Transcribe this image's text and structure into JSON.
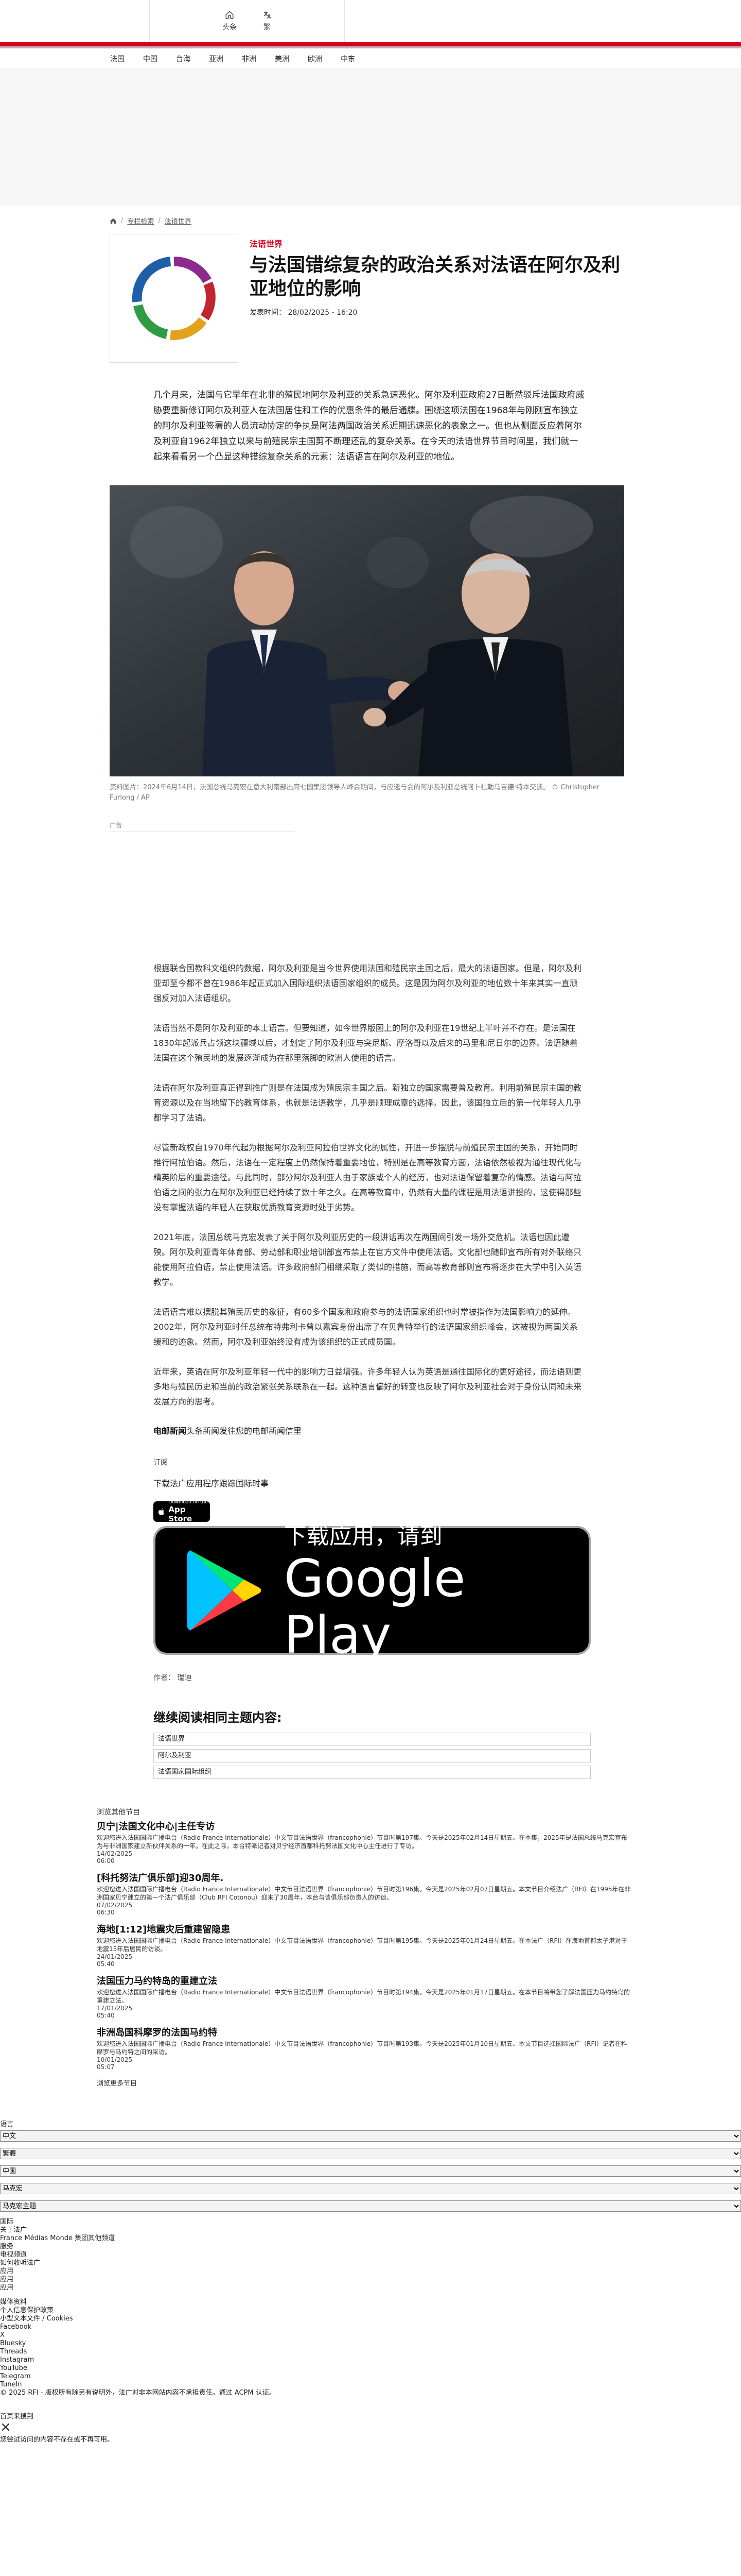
{
  "topbar": {
    "home_label": "头条",
    "lang_label": "繁"
  },
  "mainnav": [
    "法国",
    "中国",
    "台海",
    "亚洲",
    "非洲",
    "美洲",
    "欧洲",
    "中东"
  ],
  "breadcrumb": {
    "sep1": "/",
    "l1": "专栏检索",
    "sep2": "/",
    "l2": "法语世界"
  },
  "article": {
    "category": "法语世界",
    "title": "与法国错综复杂的政治关系对法语在阿尔及利亚地位的影响",
    "published": "发表时间： 28/02/2025 - 16:20",
    "lead": "几个月来，法国与它早年在北非的殖民地阿尔及利亚的关系急速恶化。阿尔及利亚政府27日断然驳斥法国政府威胁要重新修订阿尔及利亚人在法国居住和工作的优惠条件的最后通牒。围绕这项法国在1968年与刚刚宣布独立的阿尔及利亚签署的人员流动协定的争执是阿法两国政治关系近期迅速恶化的表象之一。但也从侧面反应着阿尔及利亚自1962年独立以来与前殖民宗主国剪不断理还乱的复杂关系。在今天的法语世界节目时间里，我们就一起来看看另一个凸显这种错综复杂关系的元素：法语语言在阿尔及利亚的地位。",
    "photo_caption": "资料图片：2024年6月14日，法国总统马克宏在意大利南部出席七国集团领导人峰会期间，与应邀与会的阿尔及利亚总统阿卜杜勒马吉德·特本交谈。 © Christopher Furlong / AP",
    "ad_label": "广告",
    "paragraphs": [
      "根据联合国教科文组织的数据，阿尔及利亚是当今世界使用法国和殖民宗主国之后，最大的法语国家。但是，阿尔及利亚却至今都不曾在1986年起正式加入国际组织法语国家组织的成员。这是因为阿尔及利亚的地位数十年来其实一直顽强反对加入法语组织。",
      "法语当然不是阿尔及利亚的本土语言。但要知道，如今世界版图上的阿尔及利亚在19世纪上半叶并不存在。是法国在1830年起派兵占领这块疆域以后，才划定了阿尔及利亚与突尼斯、摩洛哥以及后来的马里和尼日尔的边界。法语随着法国在这个殖民地的发展逐渐成为在那里落脚的欧洲人使用的语言。",
      "法语在阿尔及利亚真正得到推广则是在法国成为殖民宗主国之后。新独立的国家需要普及教育。利用前殖民宗主国的教育资源以及在当地留下的教育体系，也就是法语教学，几乎是顺理成章的选择。因此，该国独立后的第一代年轻人几乎都学习了法语。",
      "尽管新政权自1970年代起为根据阿尔及利亚阿拉伯世界文化的属性，开进一步摆脱与前殖民宗主国的关系，开始同时推行阿拉伯语。然后，法语在一定程度上仍然保持着重要地位，特别是在高等教育方面，法语依然被视为通往现代化与精英阶层的重要途径。与此同时，部分阿尔及利亚人由于家族或个人的经历，也对法语保留着复杂的情感。法语与阿拉伯语之间的张力在阿尔及利亚已经持续了数十年之久。在高等教育中，仍然有大量的课程是用法语讲授的，这使得那些没有掌握法语的年轻人在获取优质教育资源时处于劣势。",
      "2021年底，法国总统马克宏发表了关于阿尔及利亚历史的一段讲话再次在两国间引发一场外交危机。法语也因此遭殃。阿尔及利亚青年体育部、劳动部和职业培训部宣布禁止在官方文件中使用法语。文化部也随即宣布所有对外联络只能使用阿拉伯语，禁止使用法语。许多政府部门相继采取了类似的措施，而高等教育部则宣布将逐步在大学中引入英语教学。",
      "法语语言难以摆脱其殖民历史的象征，有60多个国家和政府参与的法语国家组织也时常被指作为法国影响力的延伸。2002年，阿尔及利亚时任总统布特弗利卡曾以嘉宾身份出席了在贝鲁特举行的法语国家组织峰会，这被视为两国关系缓和的迹象。然而，阿尔及利亚始终没有成为该组织的正式成员国。",
      "近年来，英语在阿尔及利亚年轻一代中的影响力日益增强。许多年轻人认为英语是通往国际化的更好途径，而法语则更多地与殖民历史和当前的政治紧张关系联系在一起。这种语言偏好的转变也反映了阿尔及利亚社会对于身份认同和未来发展方向的思考。"
    ],
    "read_news_prefix": "电邮新闻",
    "read_news_text": "头条新闻发往您的电邮新闻信里",
    "subscribe_btn": "订阅",
    "download_hint": "下载法广应用程序跟踪国际时事",
    "appstore_small": "Download on the",
    "appstore_big": "App Store",
    "gplay_line1": "下载应用，请到",
    "gplay_line2": "Google Play",
    "author": "作者： 瑞迪",
    "related_title": "继续阅读相同主题内容:",
    "related_tags": [
      "法语世界",
      "阿尔及利亚",
      "法语国家国际组织"
    ]
  },
  "latest": {
    "header": "浏览其他节目",
    "items": [
      {
        "title": "贝宁|法国文化中心|主任专访",
        "desc": "欢迎您进入法国国际广播电台（Radio France Internationale）中文节目法语世界（francophonie）节目时第197集。今天是2025年02月14日星期五。在本集，2025年是法国总统马克宏宣布为与非洲国家建立新伙伴关系的一年。在此之际，本台特派记者对贝宁经济首都科托努法国文化中心主任进行了专访。",
        "date": "14/02/2025\n06:00"
      },
      {
        "title": "[科托努法广俱乐部]迎30周年.",
        "desc": "欢迎您进入法国国际广播电台（Radio France Internationale）中文节目法语世界（francophonie）节目时第196集。今天是2025年02月07日星期五。本文节目介绍法广（RFI）在1995年在非洲国家贝宁建立的第一个法广俱乐部（Club RFI Cotonou）迎来了30周年，本台与该俱乐部负责人的访谈。",
        "date": "07/02/2025\n06:30"
      },
      {
        "title": "海地[1:12]地震灾后重建留隐患",
        "desc": "欢迎您进入法国国际广播电台（Radio France Internationale）中文节目法语世界（francophonie）节目时第195集。今天是2025年01月24日星期五。在本法广（RFI）在海地首都太子港对于地震15年后居民的访谈。",
        "date": "24/01/2025\n05:40"
      },
      {
        "title": "法国压力马约特岛的重建立法",
        "desc": "欢迎您进入法国国际广播电台（Radio France Internationale）中文节目法语世界（francophonie）节目时第194集。今天是2025年01月17日星期五。在本节目将带您了解法国压力马约特岛的重建立法。",
        "date": "17/01/2025\n05:40"
      },
      {
        "title": "非洲岛国科摩罗的法国马约特",
        "desc": "欢迎您进入法国国际广播电台（Radio France Internationale）中文节目法语世界（francophonie）节目时第193集。今天是2025年01月10日星期五。本文节目选择国际法广（RFI）记者在科摩罗与马约特之间的采访。",
        "date": "10/01/2025\n05:07"
      }
    ],
    "more": "浏览更多节目"
  },
  "footer": {
    "select_label": "语言",
    "languages": [
      "中文",
      "繁體",
      "中国",
      "马克宏",
      "马克宏主题"
    ],
    "lines": [
      "国际",
      "关于法广",
      "France Médias Monde 集团其他频道",
      "服务",
      "电视频道",
      "如何收听法广",
      "应用",
      "应用",
      "应用",
      "",
      "媒体资料",
      "个人信息保护政策",
      "小型文本文件 / Cookies",
      "Facebook",
      "X",
      "Bluesky",
      "Threads",
      "Instagram",
      "YouTube",
      "Telegram",
      "TuneIn",
      "© 2025 RFI - 版权所有除另有说明外，法广对非本网站内容不承担责任。通过 ACPM 认证。"
    ],
    "close_label": "首页来搜到",
    "close_note": "您尝试访问的内容不存在或不再可用。"
  }
}
